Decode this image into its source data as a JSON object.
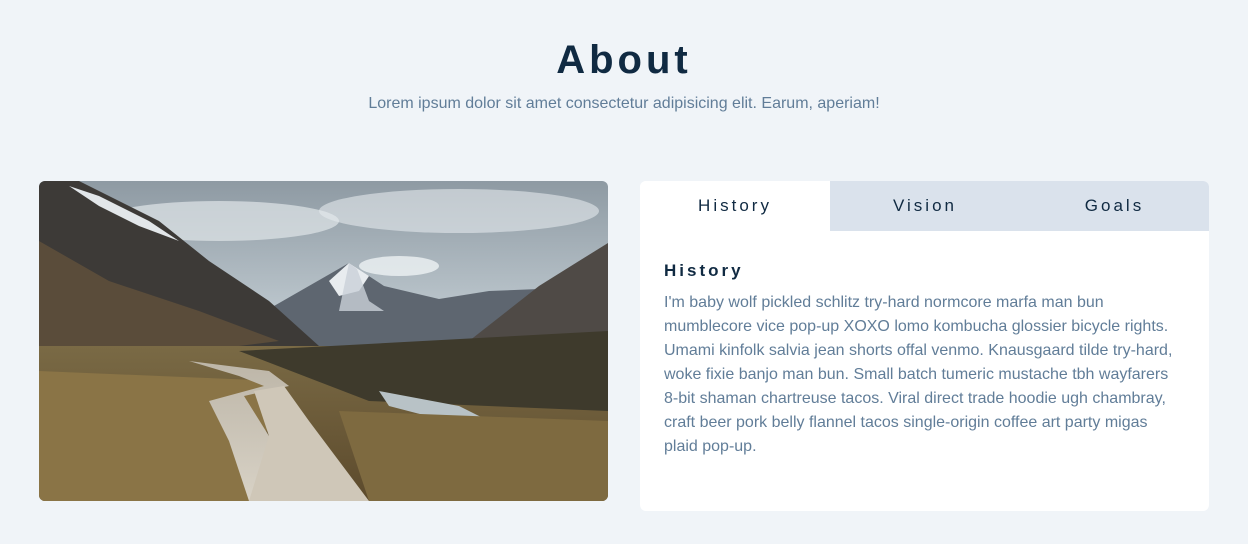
{
  "header": {
    "title": "About",
    "subtitle": "Lorem ipsum dolor sit amet consectetur adipisicing elit. Earum, aperiam!"
  },
  "tabs": [
    {
      "label": "History",
      "active": true
    },
    {
      "label": "Vision",
      "active": false
    },
    {
      "label": "Goals",
      "active": false
    }
  ],
  "content": {
    "title": "History",
    "text": "I'm baby wolf pickled schlitz try-hard normcore marfa man bun mumblecore vice pop-up XOXO lomo kombucha glossier bicycle rights. Umami kinfolk salvia jean shorts offal venmo. Knausgaard tilde try-hard, woke fixie banjo man bun. Small batch tumeric mustache tbh wayfarers 8-bit shaman chartreuse tacos. Viral direct trade hoodie ugh chambray, craft beer pork belly flannel tacos single-origin coffee art party migas plaid pop-up."
  },
  "image": {
    "alt": "mountain valley boardwalk"
  },
  "colors": {
    "background": "#f0f4f8",
    "primary_text": "#102a42",
    "secondary_text": "#617d98",
    "tab_inactive": "#dae2ec",
    "card": "#ffffff"
  }
}
